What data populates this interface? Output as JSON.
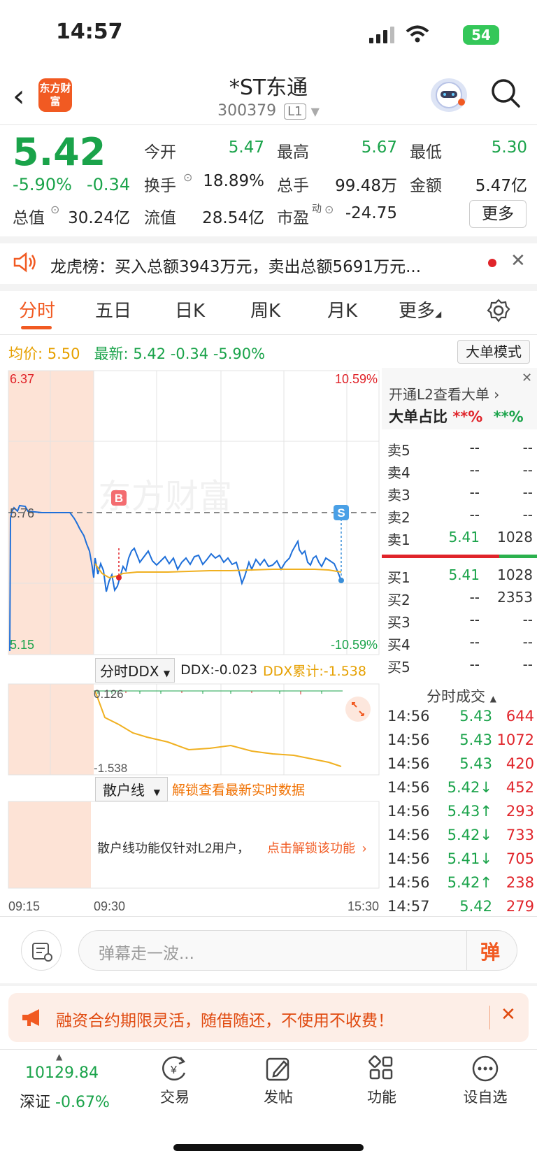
{
  "status_bar": {
    "time": "14:57",
    "battery": "54"
  },
  "header": {
    "logo_text": "东方财富",
    "stock_name": "*ST东通",
    "stock_code": "300379",
    "level": "L1"
  },
  "quote": {
    "price": "5.42",
    "change_pct": "-5.90%",
    "change_abs": "-0.34",
    "open_label": "今开",
    "open": "5.47",
    "high_label": "最高",
    "high": "5.67",
    "low_label": "最低",
    "low": "5.30",
    "turnover_label": "换手",
    "turnover": "18.89%",
    "volume_label": "总手",
    "volume": "99.48万",
    "amount_label": "金额",
    "amount": "5.47亿",
    "mktcap_label": "总值",
    "mktcap": "30.24亿",
    "float_label": "流值",
    "float": "28.54亿",
    "pe_label": "市盈",
    "pe_sup": "动",
    "pe": "-24.75",
    "more": "更多"
  },
  "notice": {
    "text": "龙虎榜：买入总额3943万元，卖出总额5691万元..."
  },
  "tabs": [
    "分时",
    "五日",
    "日K",
    "周K",
    "月K",
    "更多"
  ],
  "info": {
    "avg_label": "均价:",
    "avg": "5.50",
    "latest_label": "最新:",
    "latest": "5.42",
    "latest_chg": "-0.34",
    "latest_pct": "-5.90%",
    "big_order_btn": "大单模式"
  },
  "chart_labels": {
    "y_top": "6.37",
    "y_mid": "5.76",
    "y_bot": "5.15",
    "pct_top": "10.59%",
    "pct_bot": "-10.59%",
    "t_start": "09:15",
    "t_mid": "09:30",
    "t_end": "15:30",
    "marker_b": "B",
    "marker_s": "S",
    "watermark": "东方财富"
  },
  "ddx": {
    "selector": "分时DDX",
    "value": "DDX:-0.023",
    "cum": "DDX累计:-1.538",
    "top": "0.126",
    "bot": "-1.538"
  },
  "retail": {
    "selector": "散户线",
    "unlock": "解锁查看最新实时数据",
    "msg": "散户线功能仅针对L2用户，",
    "link": "点击解锁该功能"
  },
  "order_book": {
    "l2_open": "开通L2查看大单",
    "ratio_label": "大单占比",
    "ratio_buy": "**%",
    "ratio_sell": "**%",
    "asks": [
      {
        "label": "卖5",
        "price": "--",
        "vol": "--"
      },
      {
        "label": "卖4",
        "price": "--",
        "vol": "--"
      },
      {
        "label": "卖3",
        "price": "--",
        "vol": "--"
      },
      {
        "label": "卖2",
        "price": "--",
        "vol": "--"
      },
      {
        "label": "卖1",
        "price": "5.41",
        "vol": "1028"
      }
    ],
    "bids": [
      {
        "label": "买1",
        "price": "5.41",
        "vol": "1028"
      },
      {
        "label": "买2",
        "price": "--",
        "vol": "2353"
      },
      {
        "label": "买3",
        "price": "--",
        "vol": "--"
      },
      {
        "label": "买4",
        "price": "--",
        "vol": "--"
      },
      {
        "label": "买5",
        "price": "--",
        "vol": "--"
      }
    ]
  },
  "trades": {
    "title": "分时成交",
    "rows": [
      {
        "t": "14:56",
        "p": "5.43",
        "v": "644"
      },
      {
        "t": "14:56",
        "p": "5.43",
        "v": "1072"
      },
      {
        "t": "14:56",
        "p": "5.43",
        "v": "420"
      },
      {
        "t": "14:56",
        "p": "5.42↓",
        "v": "452"
      },
      {
        "t": "14:56",
        "p": "5.43↑",
        "v": "293"
      },
      {
        "t": "14:56",
        "p": "5.42↓",
        "v": "733"
      },
      {
        "t": "14:56",
        "p": "5.41↓",
        "v": "705"
      },
      {
        "t": "14:56",
        "p": "5.42↑",
        "v": "238"
      },
      {
        "t": "14:57",
        "p": "5.42",
        "v": "279"
      }
    ]
  },
  "danmu": {
    "placeholder": "弹幕走一波...",
    "btn": "弹"
  },
  "promo": {
    "text": "融资合约期限灵活，随借随还，不使用不收费！"
  },
  "bottom_bar": {
    "index_value": "10129.84",
    "index_name": "深证",
    "index_chg": "-0.67%",
    "trade": "交易",
    "post": "发帖",
    "func": "功能",
    "watch": "设自选"
  }
}
